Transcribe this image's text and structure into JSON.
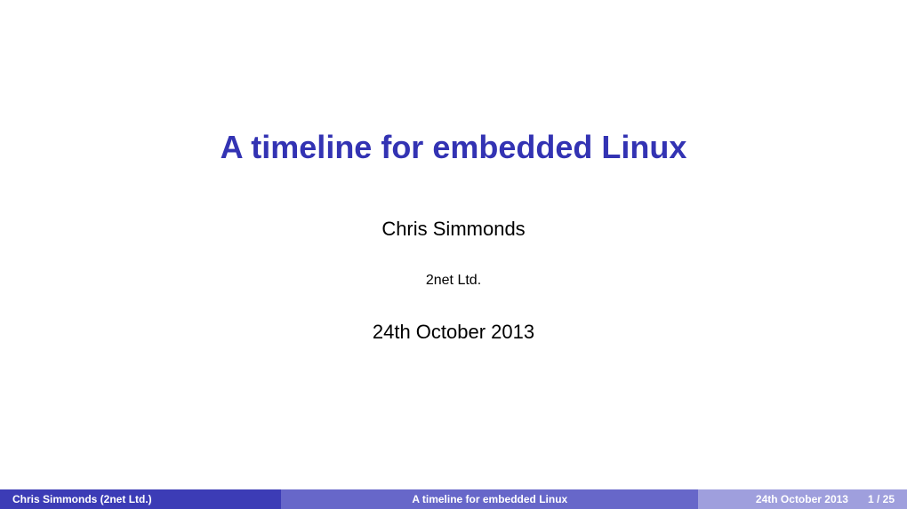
{
  "slide": {
    "title": "A timeline for embedded Linux",
    "author": "Chris Simmonds",
    "organization": "2net Ltd.",
    "date": "24th October 2013"
  },
  "footer": {
    "author": "Chris Simmonds (2net Ltd.)",
    "title": "A timeline for embedded Linux",
    "date": "24th October 2013",
    "page": "1 / 25"
  }
}
